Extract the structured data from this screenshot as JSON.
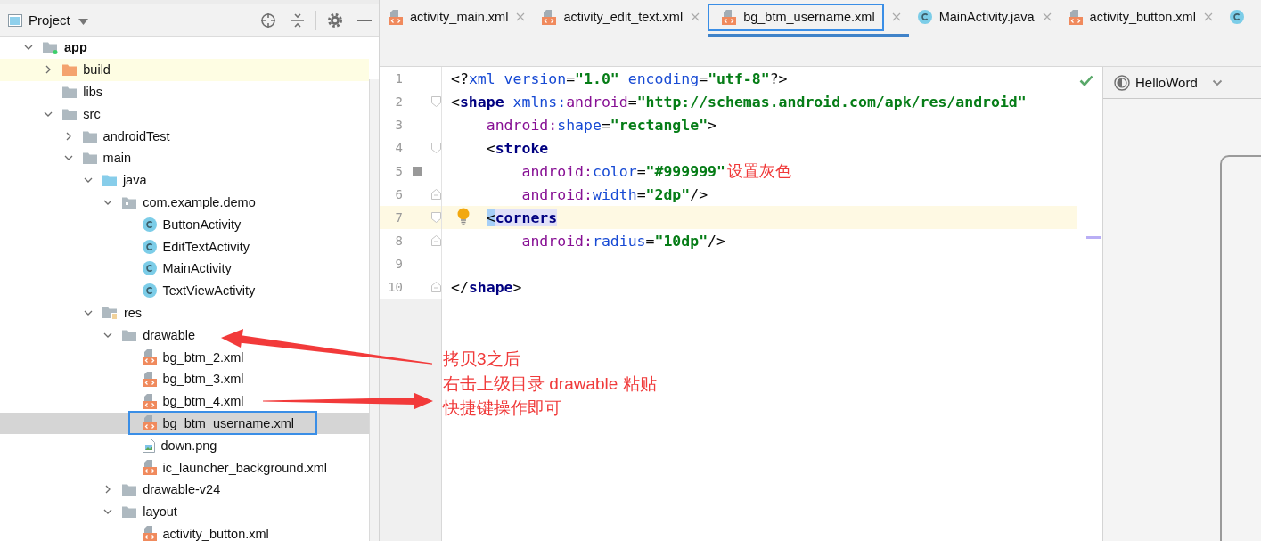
{
  "project_panel": {
    "title": "Project"
  },
  "project_tree": {
    "items": [
      {
        "label": "app",
        "kind": "module",
        "expanded": true,
        "selected": false,
        "children": [
          {
            "label": "build",
            "kind": "excluded-folder",
            "expanded": false,
            "selected": false
          },
          {
            "label": "libs",
            "kind": "folder",
            "selected": false
          },
          {
            "label": "src",
            "kind": "folder",
            "expanded": true,
            "selected": false,
            "children": [
              {
                "label": "androidTest",
                "kind": "folder",
                "expanded": false,
                "selected": false
              },
              {
                "label": "main",
                "kind": "folder",
                "expanded": true,
                "selected": false,
                "children": [
                  {
                    "label": "java",
                    "kind": "source-folder",
                    "expanded": true,
                    "selected": false,
                    "children": [
                      {
                        "label": "com.example.demo",
                        "kind": "package",
                        "expanded": true,
                        "selected": false,
                        "children": [
                          {
                            "label": "ButtonActivity",
                            "kind": "class",
                            "selected": false
                          },
                          {
                            "label": "EditTextActivity",
                            "kind": "class",
                            "selected": false
                          },
                          {
                            "label": "MainActivity",
                            "kind": "class",
                            "selected": false
                          },
                          {
                            "label": "TextViewActivity",
                            "kind": "class",
                            "selected": false
                          }
                        ]
                      }
                    ]
                  },
                  {
                    "label": "res",
                    "kind": "resource-folder",
                    "expanded": true,
                    "selected": false,
                    "children": [
                      {
                        "label": "drawable",
                        "kind": "folder",
                        "expanded": true,
                        "selected": false,
                        "children": [
                          {
                            "label": "bg_btm_2.xml",
                            "kind": "xml",
                            "selected": false
                          },
                          {
                            "label": "bg_btm_3.xml",
                            "kind": "xml",
                            "selected": false
                          },
                          {
                            "label": "bg_btm_4.xml",
                            "kind": "xml",
                            "selected": false
                          },
                          {
                            "label": "bg_btm_username.xml",
                            "kind": "xml",
                            "selected": true
                          },
                          {
                            "label": "down.png",
                            "kind": "image",
                            "selected": false
                          },
                          {
                            "label": "ic_launcher_background.xml",
                            "kind": "xml",
                            "selected": false
                          }
                        ]
                      },
                      {
                        "label": "drawable-v24",
                        "kind": "folder",
                        "expanded": false,
                        "selected": false
                      },
                      {
                        "label": "layout",
                        "kind": "folder",
                        "expanded": true,
                        "selected": false,
                        "children": [
                          {
                            "label": "activity_button.xml",
                            "kind": "xml",
                            "selected": false
                          }
                        ]
                      }
                    ]
                  }
                ]
              }
            ]
          }
        ]
      }
    ]
  },
  "editor_tabs": [
    {
      "label": "activity_main.xml",
      "kind": "xml",
      "selected": false
    },
    {
      "label": "activity_edit_text.xml",
      "kind": "xml",
      "selected": false
    },
    {
      "label": "bg_btm_username.xml",
      "kind": "xml",
      "selected": true
    },
    {
      "label": "MainActivity.java",
      "kind": "class",
      "selected": false
    },
    {
      "label": "activity_button.xml",
      "kind": "xml",
      "selected": false
    },
    {
      "kind": "class",
      "selected": false
    }
  ],
  "editor": {
    "lines": [
      {
        "number": "1",
        "current": false,
        "fold_start": false,
        "fold_end": false,
        "color_swatch": false,
        "intention_bulb": false,
        "tokens": [
          {
            "text": "<?",
            "kind": "punct"
          },
          {
            "text": "xml",
            "kind": "attr"
          },
          {
            "text": " version",
            "kind": "attr"
          },
          {
            "text": "=",
            "kind": "punct"
          },
          {
            "text": "\"1.0\"",
            "kind": "value"
          },
          {
            "text": " encoding",
            "kind": "attr"
          },
          {
            "text": "=",
            "kind": "punct"
          },
          {
            "text": "\"utf-8\"",
            "kind": "value"
          },
          {
            "text": "?>",
            "kind": "punct"
          }
        ]
      },
      {
        "number": "2",
        "current": false,
        "fold_start": true,
        "fold_end": false,
        "color_swatch": false,
        "intention_bulb": false,
        "tokens": [
          {
            "text": "<",
            "kind": "punct"
          },
          {
            "text": "shape",
            "kind": "tag"
          },
          {
            "text": " xmlns:",
            "kind": "attr"
          },
          {
            "text": "android",
            "kind": "ns"
          },
          {
            "text": "=",
            "kind": "punct"
          },
          {
            "text": "\"http://schemas.android.com/apk/res/android\"",
            "kind": "value"
          }
        ]
      },
      {
        "number": "3",
        "current": false,
        "fold_start": false,
        "fold_end": false,
        "color_swatch": false,
        "intention_bulb": false,
        "tokens": [
          {
            "text": "    android:",
            "kind": "ns"
          },
          {
            "text": "shape",
            "kind": "attr"
          },
          {
            "text": "=",
            "kind": "punct"
          },
          {
            "text": "\"rectangle\"",
            "kind": "value"
          },
          {
            "text": ">",
            "kind": "punct"
          }
        ]
      },
      {
        "number": "4",
        "current": false,
        "fold_start": true,
        "fold_end": false,
        "color_swatch": false,
        "intention_bulb": false,
        "tokens": [
          {
            "text": "    <",
            "kind": "punct"
          },
          {
            "text": "stroke",
            "kind": "tag"
          }
        ]
      },
      {
        "number": "5",
        "current": false,
        "fold_start": false,
        "fold_end": false,
        "color_swatch": true,
        "intention_bulb": false,
        "note": "设置灰色",
        "tokens": [
          {
            "text": "        android:",
            "kind": "ns"
          },
          {
            "text": "color",
            "kind": "attr"
          },
          {
            "text": "=",
            "kind": "punct"
          },
          {
            "text": "\"#999999\"",
            "kind": "value"
          }
        ]
      },
      {
        "number": "6",
        "current": false,
        "fold_start": false,
        "fold_end": true,
        "color_swatch": false,
        "intention_bulb": false,
        "tokens": [
          {
            "text": "        android:",
            "kind": "ns"
          },
          {
            "text": "width",
            "kind": "attr"
          },
          {
            "text": "=",
            "kind": "punct"
          },
          {
            "text": "\"2dp\"",
            "kind": "value"
          },
          {
            "text": "/>",
            "kind": "punct"
          }
        ]
      },
      {
        "number": "7",
        "current": true,
        "fold_start": true,
        "fold_end": false,
        "color_swatch": false,
        "intention_bulb": true,
        "tokens": [
          {
            "text": "    <",
            "kind": "caret"
          },
          {
            "text": "corners",
            "kind": "tag-match"
          }
        ]
      },
      {
        "number": "8",
        "current": false,
        "fold_start": false,
        "fold_end": true,
        "color_swatch": false,
        "intention_bulb": false,
        "tokens": [
          {
            "text": "        android:",
            "kind": "ns"
          },
          {
            "text": "radius",
            "kind": "attr"
          },
          {
            "text": "=",
            "kind": "punct"
          },
          {
            "text": "\"10dp\"",
            "kind": "value"
          },
          {
            "text": "/>",
            "kind": "punct"
          }
        ]
      },
      {
        "number": "9",
        "current": false,
        "fold_start": false,
        "fold_end": false,
        "color_swatch": false,
        "intention_bulb": false
      },
      {
        "number": "10",
        "current": false,
        "fold_start": false,
        "fold_end": true,
        "color_swatch": false,
        "intention_bulb": false,
        "tokens": [
          {
            "text": "</",
            "kind": "punct"
          },
          {
            "text": "shape",
            "kind": "tag"
          },
          {
            "text": ">",
            "kind": "punct"
          }
        ]
      }
    ]
  },
  "preview_panel": {
    "theme": "HelloWord"
  },
  "annotation_note": [
    "拷贝3之后",
    "右击上级目录 drawable 粘贴",
    "快捷键操作即可"
  ]
}
